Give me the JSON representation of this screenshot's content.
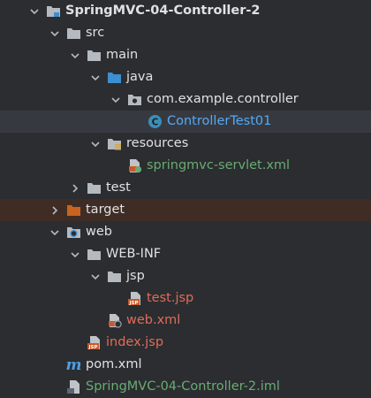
{
  "tree": {
    "project": "SpringMVC-04-Controller-2",
    "src": "src",
    "main": "main",
    "java": "java",
    "package": "com.example.controller",
    "class_file": "ControllerTest01",
    "resources": "resources",
    "servlet_xml": "springmvc-servlet.xml",
    "test": "test",
    "target": "target",
    "web": "web",
    "web_inf": "WEB-INF",
    "jsp": "jsp",
    "test_jsp": "test.jsp",
    "web_xml": "web.xml",
    "index_jsp": "index.jsp",
    "pom_xml": "pom.xml",
    "iml_file": "SpringMVC-04-Controller-2.iml",
    "jsp_badge": "JSP",
    "class_badge": "C",
    "pom_badge": "m"
  },
  "colors": {
    "background": "#2b2d30",
    "selection": "#363a40",
    "excluded_row": "#3f2d25",
    "text": "#dfe1e5",
    "vcs_added_green": "#6aab73",
    "vcs_modified_blue": "#56a8f5",
    "vcs_unversioned_red": "#e06c5a",
    "folder": "#b5b9c0",
    "source_folder": "#3c8fd0",
    "excluded_folder": "#c8641f"
  },
  "icons": {
    "expand": "chevron-down-icon",
    "collapse": "chevron-right-icon",
    "folder": "folder-icon",
    "module": "module-folder-icon",
    "source_root": "source-root-folder-icon",
    "package": "package-icon",
    "class": "java-class-icon",
    "resources_root": "resources-root-folder-icon",
    "xml": "spring-xml-icon",
    "excluded": "excluded-folder-icon",
    "web": "web-folder-icon",
    "jsp": "jsp-file-icon",
    "web_xml": "web-xml-icon",
    "maven": "maven-pom-icon",
    "iml": "iml-file-icon"
  }
}
